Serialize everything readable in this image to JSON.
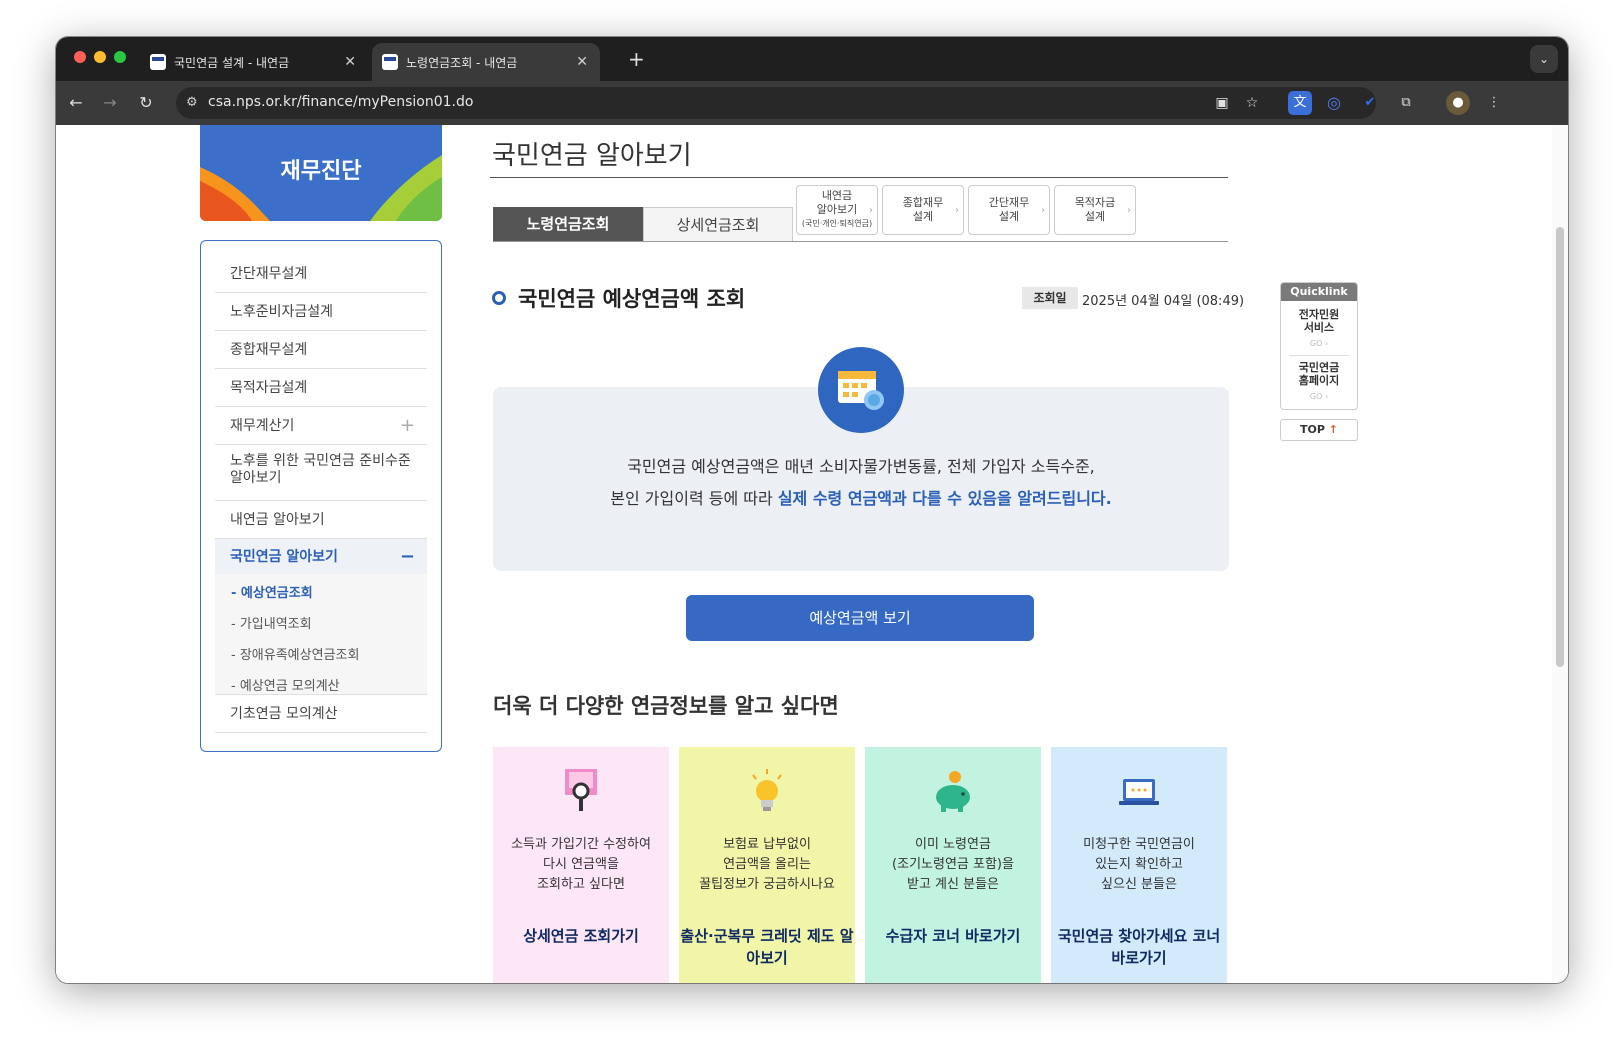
{
  "browser": {
    "tabs": [
      {
        "label": "국민연금 설계 - 내연금",
        "active": false
      },
      {
        "label": "노령연금조회 - 내연금",
        "active": true
      }
    ],
    "new_tab": "+",
    "url": "csa.nps.or.kr/finance/myPension01.do"
  },
  "sidebar": {
    "banner_title": "재무진단",
    "items": [
      {
        "label": "간단재무설계"
      },
      {
        "label": "노후준비자금설계"
      },
      {
        "label": "종합재무설계"
      },
      {
        "label": "목적자금설계"
      },
      {
        "label": "재무계산기",
        "expand": "+"
      },
      {
        "label": "노후를 위한 국민연금 준비수준 알아보기"
      },
      {
        "label": "내연금 알아보기"
      },
      {
        "label": "국민연금 알아보기",
        "collapse": "−"
      },
      {
        "label": "기초연금 모의계산"
      }
    ],
    "subitems": [
      {
        "label": "- 예상연금조회"
      },
      {
        "label": "- 가입내역조회"
      },
      {
        "label": "- 장애유족예상연금조회"
      },
      {
        "label": "- 예상연금 모의계산"
      }
    ]
  },
  "main": {
    "page_title": "국민연금 알아보기",
    "tabs": [
      {
        "label": "노령연금조회"
      },
      {
        "label": "상세연금조회"
      }
    ],
    "shortcut_tabs": [
      {
        "line1": "내연금",
        "line2": "알아보기",
        "line3": "(국민·개인·퇴직연금)"
      },
      {
        "line1": "종합재무",
        "line2": "설계"
      },
      {
        "line1": "간단재무",
        "line2": "설계"
      },
      {
        "line1": "목적자금",
        "line2": "설계"
      }
    ],
    "section_title": "국민연금 예상연금액 조회",
    "date_label": "조회일",
    "date_value": "2025년 04월 04일 (08:49)",
    "info_line1": "국민연금 예상연금액은 매년 소비자물가변동률, 전체 가입자 소득수준,",
    "info_line2_plain": "본인 가입이력 등에 따라 ",
    "info_line2_highlight": "실제 수령 연금액과 다를 수 있음을 알려드립니다.",
    "view_button": "예상연금액 보기",
    "more_title": "더욱 더 다양한 연금정보를 알고 싶다면",
    "cards": [
      {
        "desc1": "소득과 가입기간 수정하여",
        "desc2": "다시 연금액을",
        "desc3": "조회하고 싶다면",
        "link": "상세연금 조회가기",
        "bg": "#fde7f6"
      },
      {
        "desc1": "보험료 납부없이",
        "desc2": "연금액을 올리는",
        "desc3": "꿀팁정보가 궁금하시나요",
        "link": "출산·군복무 크레딧 제도 알아보기",
        "bg": "#f1f5a7"
      },
      {
        "desc1": "이미 노령연금",
        "desc2": "(조기노령연금 포함)을",
        "desc3": "받고 계신 분들은",
        "link": "수급자 코너 바로가기",
        "bg": "#c1f3e0"
      },
      {
        "desc1": "미청구한 국민연금이",
        "desc2": "있는지 확인하고",
        "desc3": "싶으신 분들은",
        "link": "국민연금 찾아가세요 코너 바로가기",
        "bg": "#d2eaf9"
      }
    ]
  },
  "quicklink": {
    "title": "Quicklink",
    "items": [
      {
        "line1": "전자민원",
        "line2": "서비스",
        "go": "GO ›"
      },
      {
        "line1": "국민연금",
        "line2": "홈페이지",
        "go": "GO ›"
      }
    ],
    "top_label": "TOP",
    "top_arrow": "↑"
  }
}
